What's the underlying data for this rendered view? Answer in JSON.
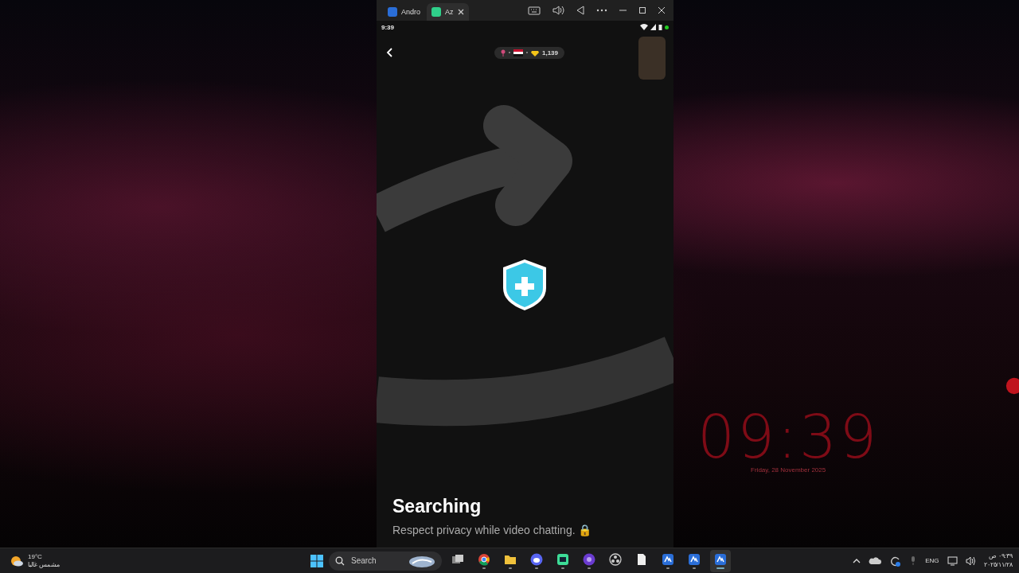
{
  "emulator": {
    "tabs": [
      {
        "label": "Andro",
        "selected": false
      },
      {
        "label": "Az",
        "selected": true
      }
    ]
  },
  "phone": {
    "status_time": "9:39",
    "coins": "1,139",
    "title": "Searching",
    "subtitle": "Respect privacy while video chatting. 🔒"
  },
  "desktop_clock": {
    "time": "09:39",
    "date": "Friday, 28 November 2025"
  },
  "taskbar": {
    "weather": {
      "temp": "19°C",
      "condition": "مشمس غالبا"
    },
    "search": {
      "placeholder": "Search"
    },
    "apps": [
      {
        "kind": "taskview",
        "running": false,
        "selected": false
      },
      {
        "kind": "chrome",
        "running": true,
        "selected": false
      },
      {
        "kind": "folder",
        "running": true,
        "selected": false
      },
      {
        "kind": "discord",
        "running": true,
        "selected": false
      },
      {
        "kind": "green",
        "running": true,
        "selected": false
      },
      {
        "kind": "purple",
        "running": true,
        "selected": false
      },
      {
        "kind": "obs",
        "running": false,
        "selected": false
      },
      {
        "kind": "document",
        "running": false,
        "selected": false
      },
      {
        "kind": "blue",
        "running": true,
        "selected": false
      },
      {
        "kind": "blue",
        "running": true,
        "selected": false
      },
      {
        "kind": "blue",
        "running": true,
        "selected": true
      }
    ],
    "language": "ENG",
    "time": "٠٩:٣٩ ص",
    "date": "٢٠٢٥/١١/٢٨"
  }
}
